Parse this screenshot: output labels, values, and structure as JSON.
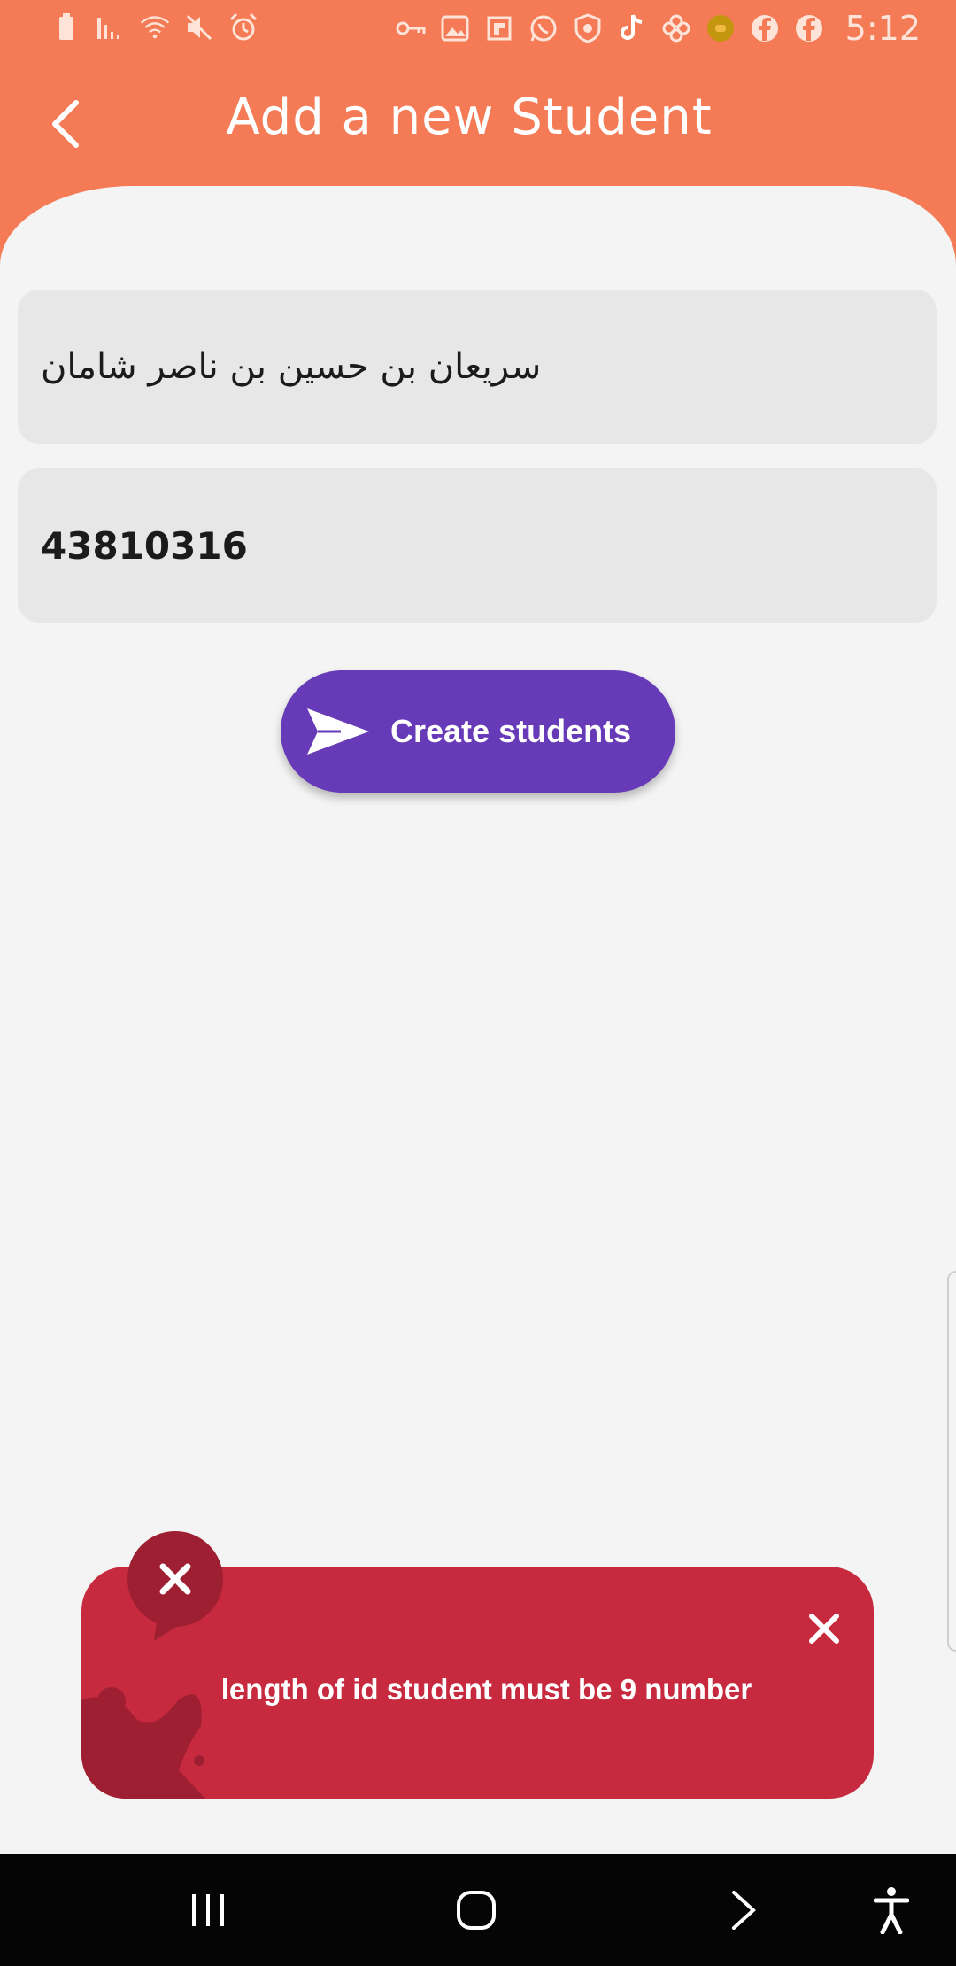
{
  "status_bar": {
    "time": "5:12",
    "left_icons": [
      "battery-icon",
      "signal-icon",
      "wifi-icon",
      "mute-icon",
      "alarm-icon"
    ],
    "right_icons": [
      "vpn-key-icon",
      "gallery-icon",
      "flipboard-icon",
      "whatsapp-icon",
      "shield-icon",
      "tiktok-icon",
      "settings-flower-icon",
      "app-icon",
      "facebook-icon",
      "facebook-icon"
    ]
  },
  "header": {
    "title": "Add a new Student",
    "back_icon": "chevron-left-icon",
    "color": "#f47b55"
  },
  "form": {
    "name_value": "سريعان بن حسين بن ناصر شامان",
    "id_value": "43810316",
    "submit_label": "Create students",
    "submit_color": "#673ab7"
  },
  "snackbar": {
    "message": "length of id student must be 9 number",
    "color": "#c72a3f",
    "icon": "close-icon"
  },
  "navbar": {
    "buttons": [
      "recents-icon",
      "home-icon",
      "back-icon",
      "accessibility-icon"
    ]
  }
}
